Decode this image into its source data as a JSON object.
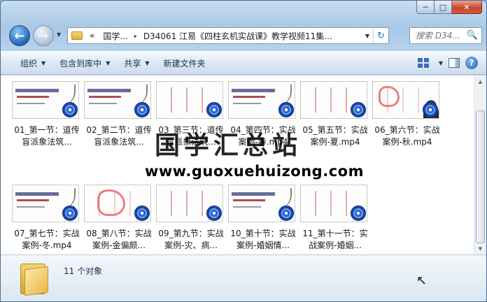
{
  "window": {
    "caption": {
      "minimize": "─",
      "maximize": "□",
      "close": "✕"
    }
  },
  "nav": {
    "back_glyph": "←",
    "forward_glyph": "→",
    "history_glyph": "▼",
    "address": {
      "overflow": "«",
      "segments": [
        "国学...",
        "D34061 江易《四柱玄机实战课》教学视频11集..."
      ],
      "separator": "▸",
      "dropdown": "▼",
      "refresh_glyph": "↻"
    },
    "search": {
      "placeholder": "搜索 D34...",
      "icon": "search-icon",
      "glyph": "🔍"
    }
  },
  "toolbar": {
    "items": [
      {
        "label": "组织",
        "caret": "▼"
      },
      {
        "label": "包含到库中",
        "caret": "▼"
      },
      {
        "label": "共享",
        "caret": "▼"
      },
      {
        "label": "新建文件夹"
      }
    ],
    "help_glyph": "?"
  },
  "files": [
    {
      "name": "01_第一节：道传盲派象法筑...",
      "thumb": "title"
    },
    {
      "name": "02_第二节：道传盲派象法筑...",
      "thumb": "title"
    },
    {
      "name": "03_第三节：道传盲派象法筑...",
      "thumb": "chart"
    },
    {
      "name": "04_第四节：实战案例-春.mp4",
      "thumb": "title"
    },
    {
      "name": "05_第五节：实战案例-夏.mp4",
      "thumb": "chart"
    },
    {
      "name": "06_第六节：实战案例-秋.mp4",
      "thumb": "person"
    },
    {
      "name": "07_第七节：实战案例-冬.mp4",
      "thumb": "title"
    },
    {
      "name": "08_第八节：实战案例-金偏颇...",
      "thumb": "scrawl"
    },
    {
      "name": "09_第九节：实战案例-灾、病...",
      "thumb": "chart"
    },
    {
      "name": "10_第十节：实战案例-婚姻情...",
      "thumb": "title"
    },
    {
      "name": "11_第十一节：实战案例-婚姻...",
      "thumb": "chart"
    }
  ],
  "watermark": {
    "text_cn": "国学汇总站",
    "url": "www.guoxuehuizong.com"
  },
  "details": {
    "count": "11 个对象"
  },
  "scrollbar": {
    "up": "▲",
    "down": "▼"
  }
}
